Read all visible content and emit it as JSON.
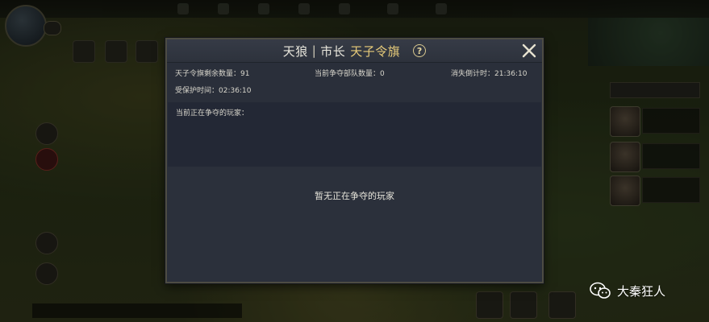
{
  "dialog": {
    "title": {
      "part1": "天狼",
      "separator": "|",
      "part2": "市长",
      "part3": "天子令旗"
    },
    "help_icon": "question-circle-icon",
    "close_icon": "close-x-icon",
    "stats": {
      "flags_remaining": "天子令旗剩余数量：91",
      "contending_troops": "当前争夺部队数量：0",
      "countdown": "消失倒计时：21:36:10",
      "protection_time": "受保护时间：02:36:10"
    },
    "contenders_label": "当前正在争夺的玩家：",
    "empty_message": "暂无正在争夺的玩家"
  },
  "watermark": {
    "icon": "wechat-icon",
    "text": "大秦狂人"
  },
  "colors": {
    "dialog_bg": "#2a2f3a",
    "title_gold": "#e8cc7a",
    "text": "#d8d6cc"
  }
}
